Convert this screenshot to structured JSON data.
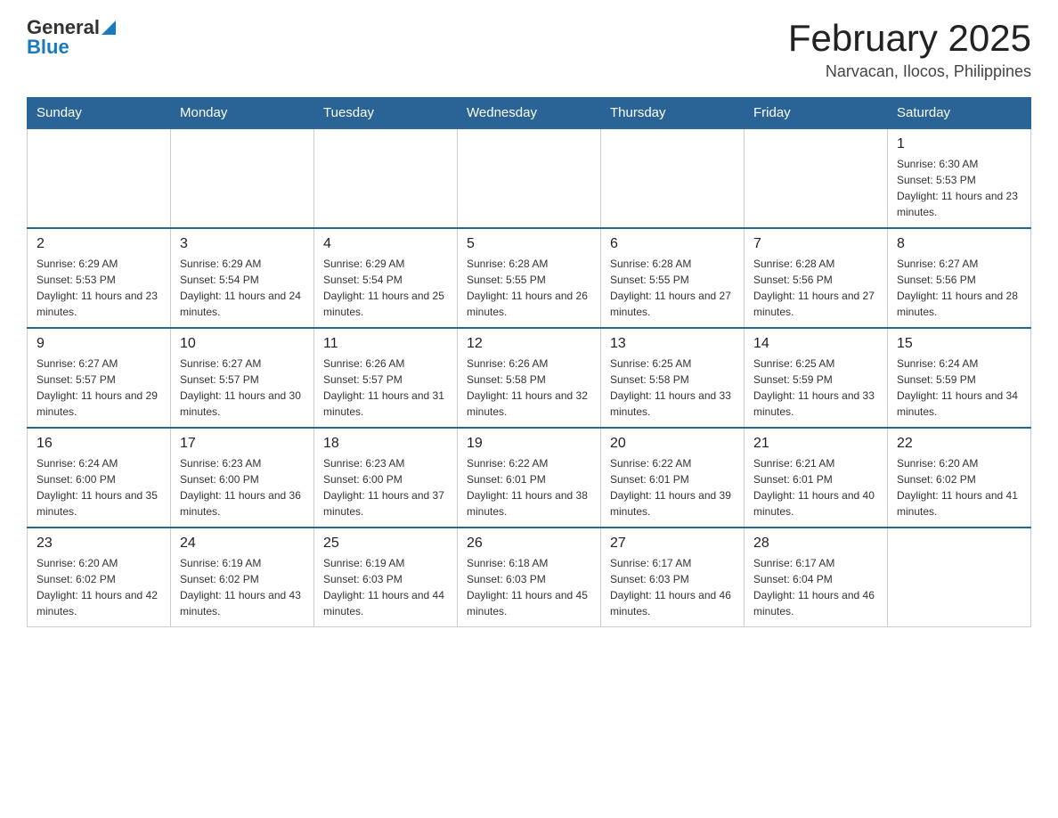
{
  "header": {
    "logo_general": "General",
    "logo_blue": "Blue",
    "title": "February 2025",
    "subtitle": "Narvacan, Ilocos, Philippines"
  },
  "days_of_week": [
    "Sunday",
    "Monday",
    "Tuesday",
    "Wednesday",
    "Thursday",
    "Friday",
    "Saturday"
  ],
  "weeks": [
    {
      "days": [
        {
          "date": "",
          "info": ""
        },
        {
          "date": "",
          "info": ""
        },
        {
          "date": "",
          "info": ""
        },
        {
          "date": "",
          "info": ""
        },
        {
          "date": "",
          "info": ""
        },
        {
          "date": "",
          "info": ""
        },
        {
          "date": "1",
          "info": "Sunrise: 6:30 AM\nSunset: 5:53 PM\nDaylight: 11 hours and 23 minutes."
        }
      ]
    },
    {
      "days": [
        {
          "date": "2",
          "info": "Sunrise: 6:29 AM\nSunset: 5:53 PM\nDaylight: 11 hours and 23 minutes."
        },
        {
          "date": "3",
          "info": "Sunrise: 6:29 AM\nSunset: 5:54 PM\nDaylight: 11 hours and 24 minutes."
        },
        {
          "date": "4",
          "info": "Sunrise: 6:29 AM\nSunset: 5:54 PM\nDaylight: 11 hours and 25 minutes."
        },
        {
          "date": "5",
          "info": "Sunrise: 6:28 AM\nSunset: 5:55 PM\nDaylight: 11 hours and 26 minutes."
        },
        {
          "date": "6",
          "info": "Sunrise: 6:28 AM\nSunset: 5:55 PM\nDaylight: 11 hours and 27 minutes."
        },
        {
          "date": "7",
          "info": "Sunrise: 6:28 AM\nSunset: 5:56 PM\nDaylight: 11 hours and 27 minutes."
        },
        {
          "date": "8",
          "info": "Sunrise: 6:27 AM\nSunset: 5:56 PM\nDaylight: 11 hours and 28 minutes."
        }
      ]
    },
    {
      "days": [
        {
          "date": "9",
          "info": "Sunrise: 6:27 AM\nSunset: 5:57 PM\nDaylight: 11 hours and 29 minutes."
        },
        {
          "date": "10",
          "info": "Sunrise: 6:27 AM\nSunset: 5:57 PM\nDaylight: 11 hours and 30 minutes."
        },
        {
          "date": "11",
          "info": "Sunrise: 6:26 AM\nSunset: 5:57 PM\nDaylight: 11 hours and 31 minutes."
        },
        {
          "date": "12",
          "info": "Sunrise: 6:26 AM\nSunset: 5:58 PM\nDaylight: 11 hours and 32 minutes."
        },
        {
          "date": "13",
          "info": "Sunrise: 6:25 AM\nSunset: 5:58 PM\nDaylight: 11 hours and 33 minutes."
        },
        {
          "date": "14",
          "info": "Sunrise: 6:25 AM\nSunset: 5:59 PM\nDaylight: 11 hours and 33 minutes."
        },
        {
          "date": "15",
          "info": "Sunrise: 6:24 AM\nSunset: 5:59 PM\nDaylight: 11 hours and 34 minutes."
        }
      ]
    },
    {
      "days": [
        {
          "date": "16",
          "info": "Sunrise: 6:24 AM\nSunset: 6:00 PM\nDaylight: 11 hours and 35 minutes."
        },
        {
          "date": "17",
          "info": "Sunrise: 6:23 AM\nSunset: 6:00 PM\nDaylight: 11 hours and 36 minutes."
        },
        {
          "date": "18",
          "info": "Sunrise: 6:23 AM\nSunset: 6:00 PM\nDaylight: 11 hours and 37 minutes."
        },
        {
          "date": "19",
          "info": "Sunrise: 6:22 AM\nSunset: 6:01 PM\nDaylight: 11 hours and 38 minutes."
        },
        {
          "date": "20",
          "info": "Sunrise: 6:22 AM\nSunset: 6:01 PM\nDaylight: 11 hours and 39 minutes."
        },
        {
          "date": "21",
          "info": "Sunrise: 6:21 AM\nSunset: 6:01 PM\nDaylight: 11 hours and 40 minutes."
        },
        {
          "date": "22",
          "info": "Sunrise: 6:20 AM\nSunset: 6:02 PM\nDaylight: 11 hours and 41 minutes."
        }
      ]
    },
    {
      "days": [
        {
          "date": "23",
          "info": "Sunrise: 6:20 AM\nSunset: 6:02 PM\nDaylight: 11 hours and 42 minutes."
        },
        {
          "date": "24",
          "info": "Sunrise: 6:19 AM\nSunset: 6:02 PM\nDaylight: 11 hours and 43 minutes."
        },
        {
          "date": "25",
          "info": "Sunrise: 6:19 AM\nSunset: 6:03 PM\nDaylight: 11 hours and 44 minutes."
        },
        {
          "date": "26",
          "info": "Sunrise: 6:18 AM\nSunset: 6:03 PM\nDaylight: 11 hours and 45 minutes."
        },
        {
          "date": "27",
          "info": "Sunrise: 6:17 AM\nSunset: 6:03 PM\nDaylight: 11 hours and 46 minutes."
        },
        {
          "date": "28",
          "info": "Sunrise: 6:17 AM\nSunset: 6:04 PM\nDaylight: 11 hours and 46 minutes."
        },
        {
          "date": "",
          "info": ""
        }
      ]
    }
  ]
}
